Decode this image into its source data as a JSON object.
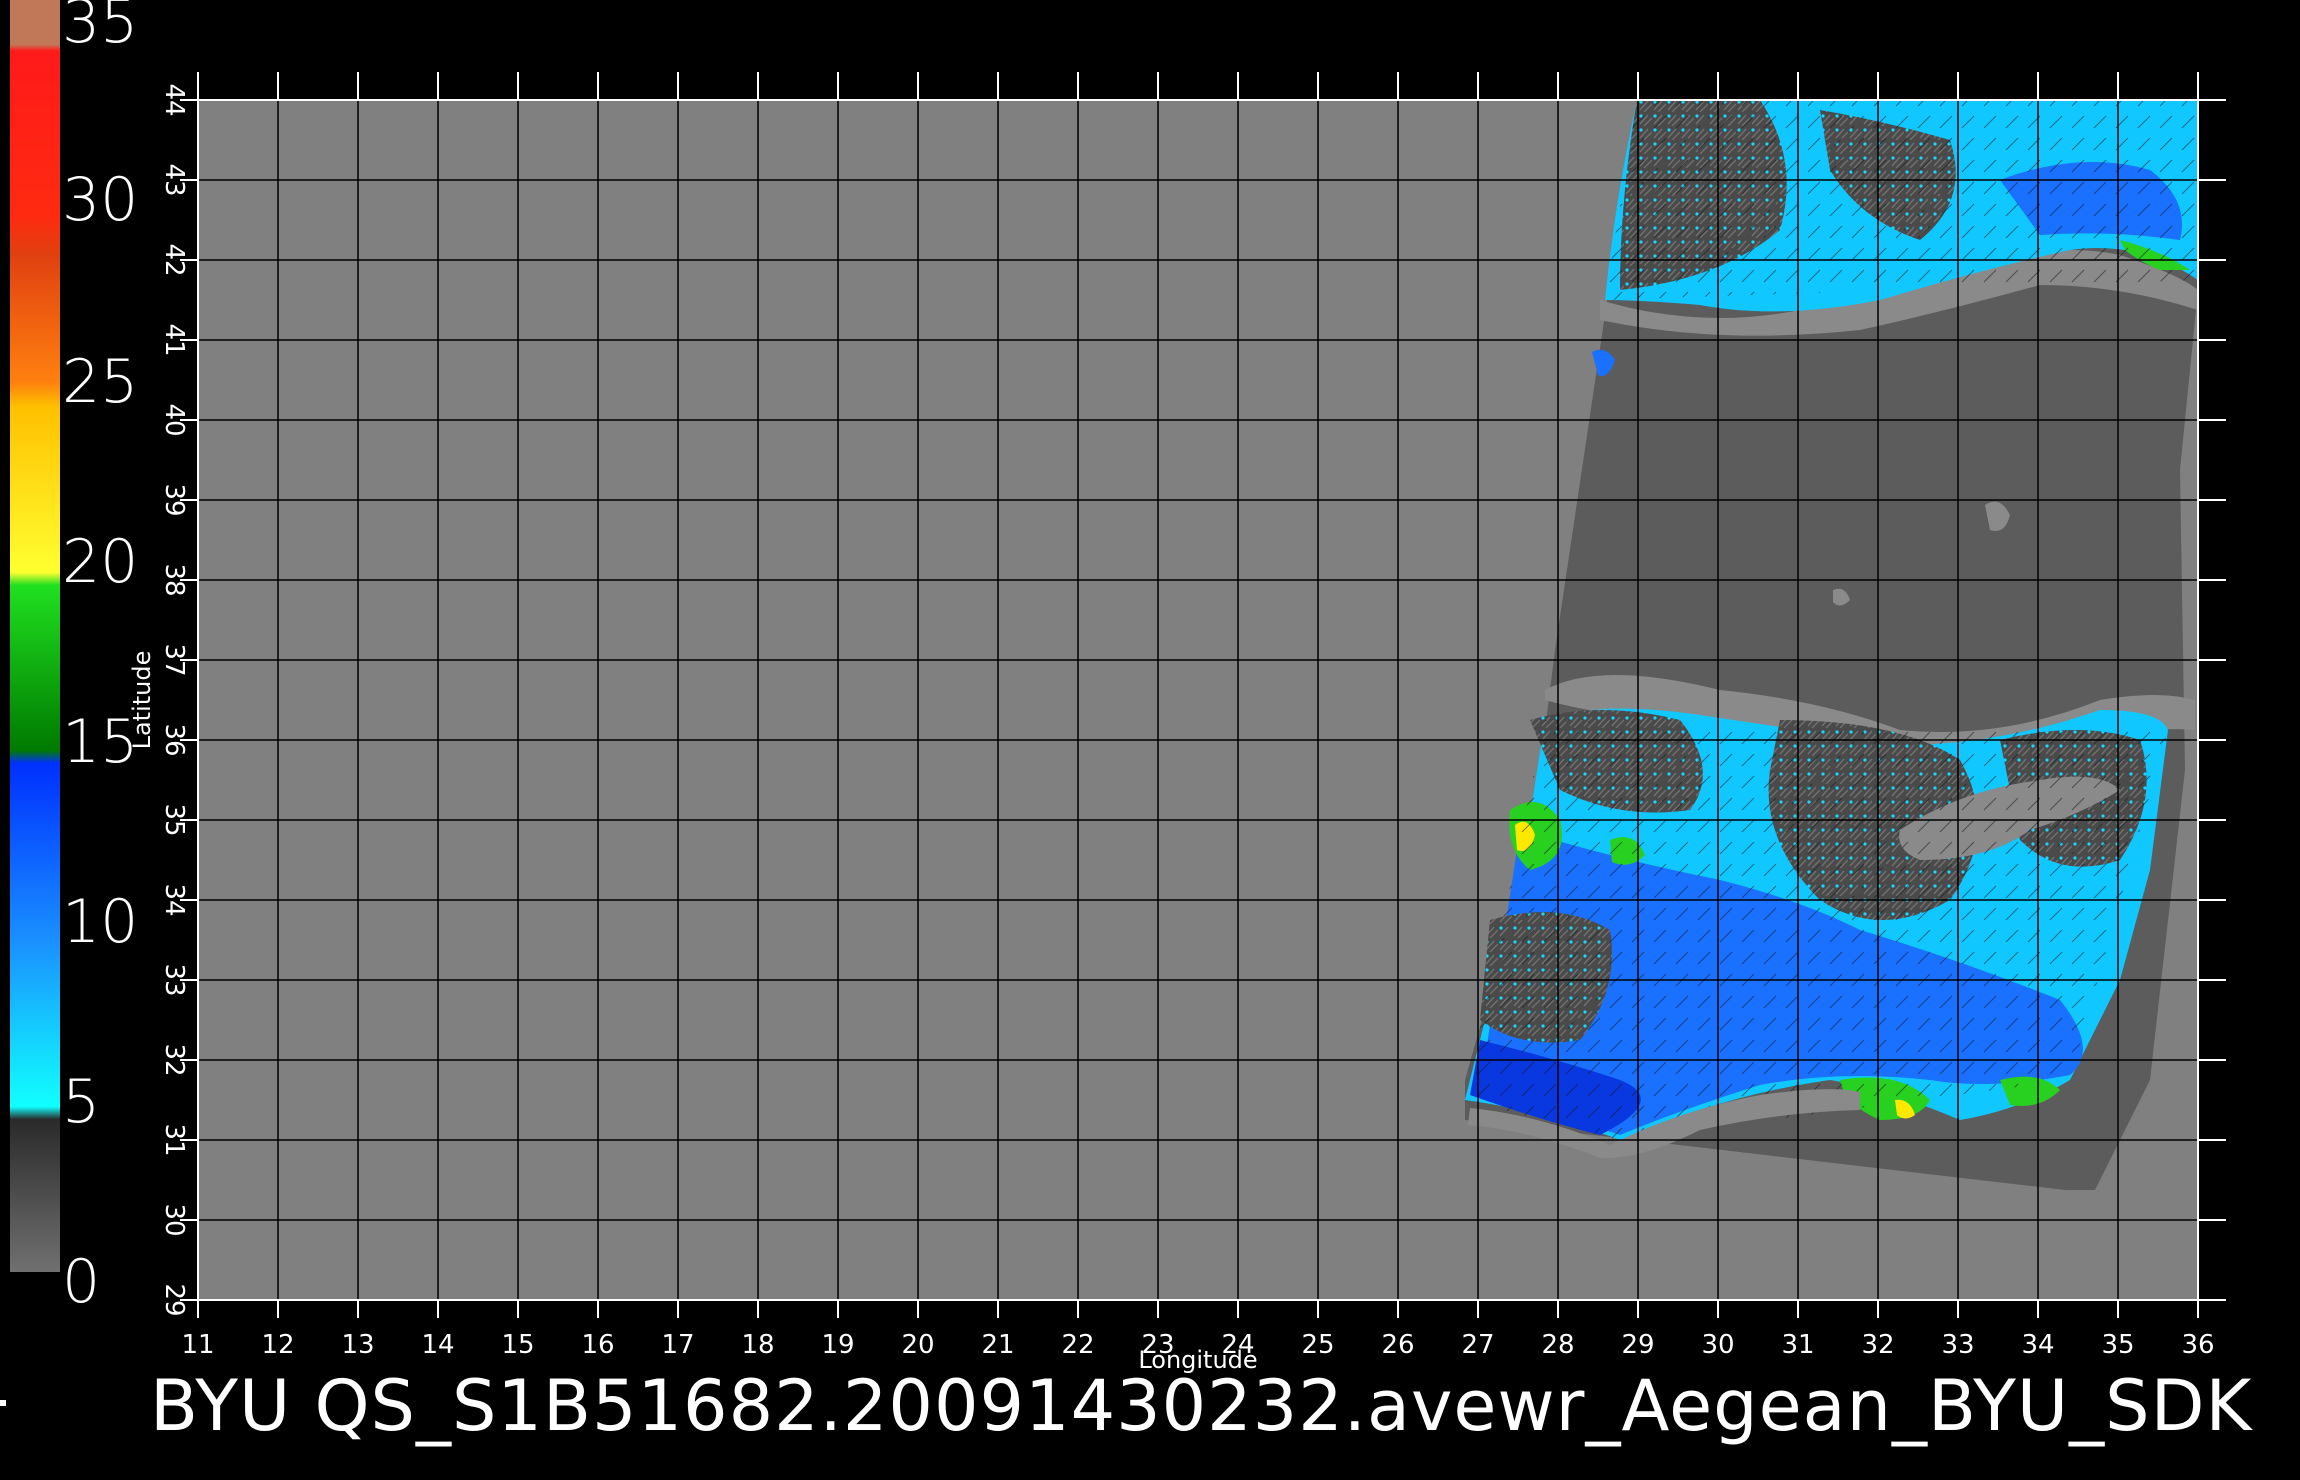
{
  "colorbar": {
    "labels": [
      "35",
      "30",
      "25",
      "20",
      "15",
      "10",
      "5",
      "0"
    ],
    "segments": [
      {
        "color": "#c08060"
      },
      {
        "color": "#ff2020"
      },
      {
        "color": "#e85010"
      },
      {
        "color": "#ffd000"
      },
      {
        "color": "#18c018"
      },
      {
        "color": "#1060ff"
      },
      {
        "color": "#10c8ff"
      },
      {
        "color": "#404040"
      }
    ]
  },
  "map": {
    "x_label": "Longitude",
    "y_label": "Latitude",
    "lon_range": [
      11,
      36
    ],
    "lat_range": [
      29,
      44
    ],
    "lon_ticks": [
      "11",
      "12",
      "13",
      "14",
      "15",
      "16",
      "17",
      "18",
      "19",
      "20",
      "21",
      "22",
      "23",
      "24",
      "25",
      "26",
      "27",
      "28",
      "29",
      "30",
      "31",
      "32",
      "33",
      "34",
      "35",
      "36"
    ],
    "lat_ticks": [
      "29",
      "30",
      "31",
      "32",
      "33",
      "34",
      "35",
      "36",
      "37",
      "38",
      "39",
      "40",
      "41",
      "42",
      "43",
      "44"
    ],
    "colors": {
      "background": "#808080",
      "land": "#5a5a5a",
      "swath_mask": "#5c5c5c",
      "coast": "#888888",
      "wind_low": "#10d0ff",
      "wind_mid": "#1a70ff",
      "wind_high": "#0a38e0",
      "wind_green": "#28d020",
      "wind_yellow": "#ffe800",
      "grid": "#000000"
    }
  },
  "footer": {
    "title": "BYU  QS_S1B51682.20091430232.avewr_Aegean_BYU_SDK"
  }
}
